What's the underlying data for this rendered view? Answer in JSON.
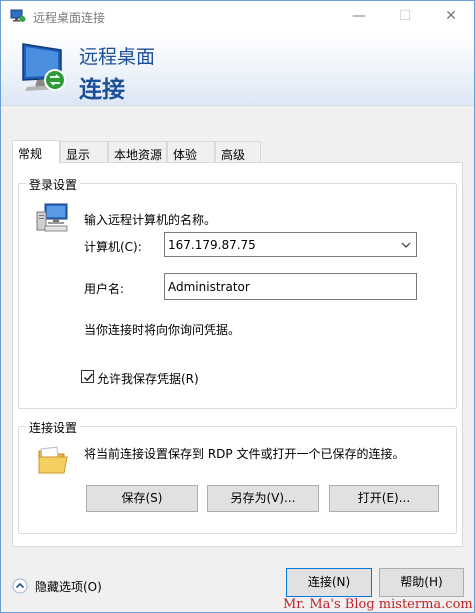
{
  "window": {
    "title": "远程桌面连接"
  },
  "titlebar_buttons": {
    "minimize": "—",
    "maximize": "☐",
    "close": "✕"
  },
  "banner": {
    "title": "远程桌面",
    "subtitle": "连接"
  },
  "tabs": [
    {
      "label": "常规",
      "active": true
    },
    {
      "label": "显示",
      "active": false
    },
    {
      "label": "本地资源",
      "active": false
    },
    {
      "label": "体验",
      "active": false
    },
    {
      "label": "高级",
      "active": false
    }
  ],
  "login": {
    "group_label": "登录设置",
    "prompt": "输入远程计算机的名称。",
    "computer_label": "计算机(C):",
    "computer_value": "167.179.87.75",
    "username_label": "用户名:",
    "username_value": "Administrator",
    "credentials_note": "当你连接时将向你询问凭据。",
    "save_credentials_label": "允许我保存凭据(R)",
    "save_credentials_checked": true
  },
  "connection": {
    "group_label": "连接设置",
    "description": "将当前连接设置保存到 RDP 文件或打开一个已保存的连接。",
    "save_button": "保存(S)",
    "save_as_button": "另存为(V)...",
    "open_button": "打开(E)..."
  },
  "footer": {
    "hide_options": "隐藏选项(O)",
    "connect_button": "连接(N)",
    "help_button": "帮助(H)"
  },
  "watermark": "Mr. Ma's Blog  misterma.com",
  "colors": {
    "accent_blue": "#1b4f9a",
    "watermark_red": "#c0232a"
  }
}
